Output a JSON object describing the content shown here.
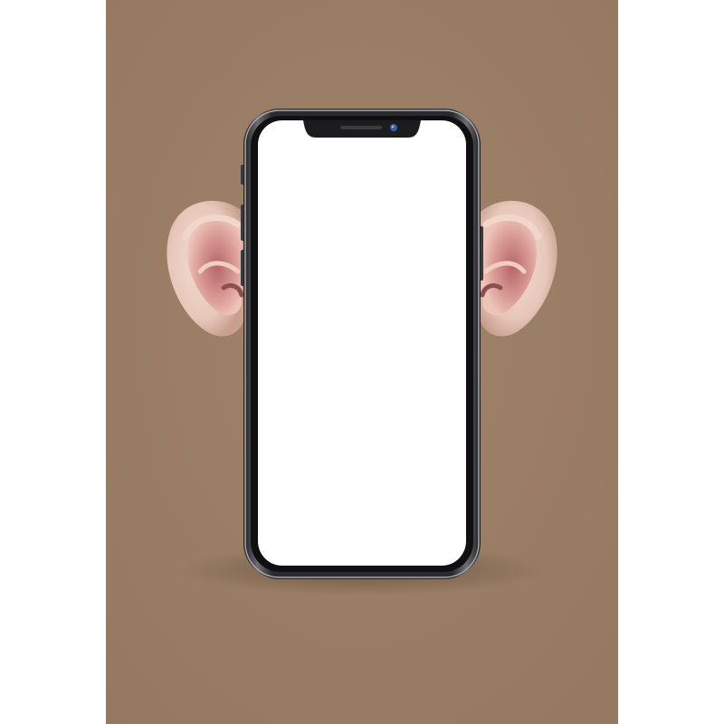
{
  "scene": {
    "subject": "smartphone-with-ears",
    "colors": {
      "page_background": "#ffffff",
      "poster_background": "#9a7e66",
      "phone_frame": "#2b2b2d",
      "phone_frame_highlight": "#9c9ca0",
      "screen": "#ffffff",
      "notch": "#1c1c1e",
      "camera_lens": "#3a5fa8",
      "ear_skin": "#ead1c6",
      "ear_inner": "#d7958f"
    },
    "screen": {
      "content": ""
    }
  }
}
